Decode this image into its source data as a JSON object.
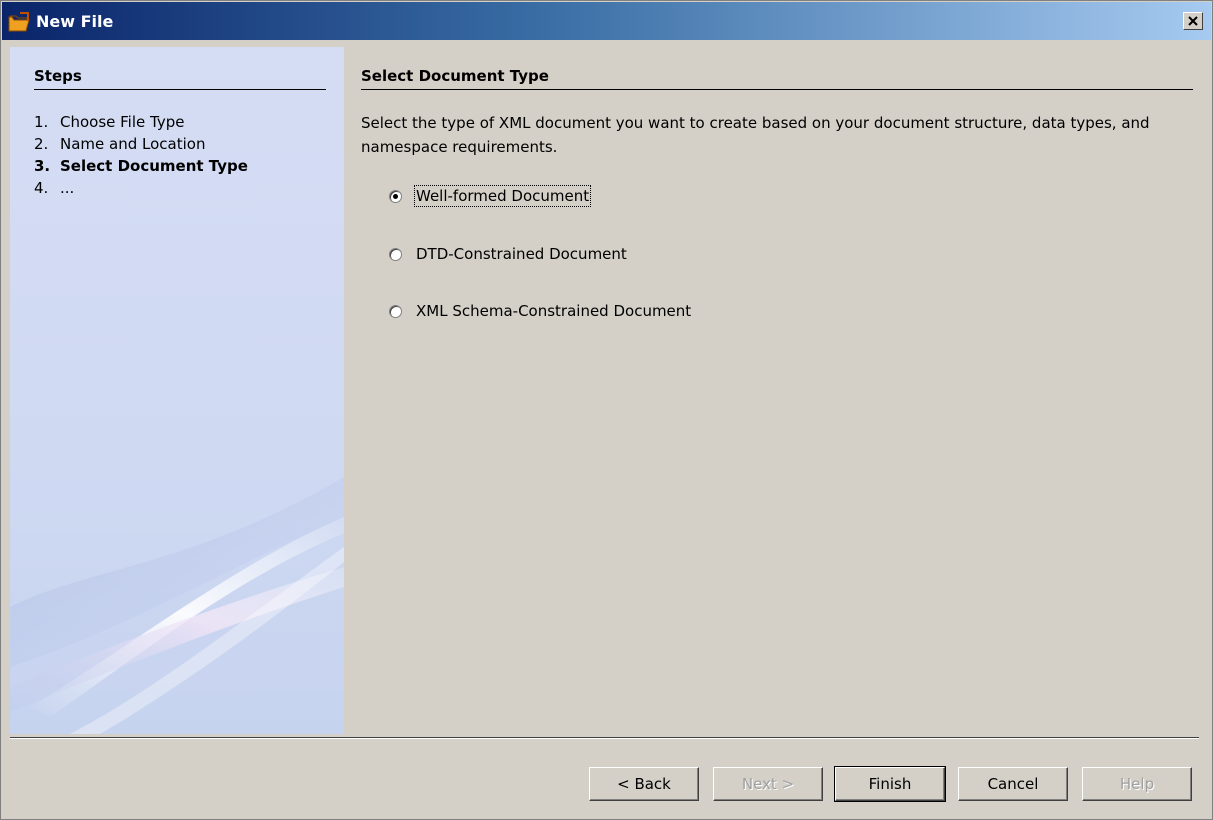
{
  "window": {
    "title": "New File",
    "close_glyph": "✕"
  },
  "steps": {
    "heading": "Steps",
    "items": [
      {
        "number": "1.",
        "label": "Choose File Type",
        "current": false
      },
      {
        "number": "2.",
        "label": "Name and Location",
        "current": false
      },
      {
        "number": "3.",
        "label": "Select Document Type",
        "current": true
      },
      {
        "number": "4.",
        "label": "...",
        "current": false
      }
    ]
  },
  "content": {
    "heading": "Select Document Type",
    "description": "Select the type of XML document you want to create based on your document structure, data types, and namespace requirements.",
    "options": [
      {
        "label": "Well-formed Document",
        "selected": true
      },
      {
        "label": "DTD-Constrained Document",
        "selected": false
      },
      {
        "label": "XML Schema-Constrained Document",
        "selected": false
      }
    ]
  },
  "buttons": {
    "back": "< Back",
    "next": "Next >",
    "finish": "Finish",
    "cancel": "Cancel",
    "help": "Help"
  },
  "icons": {
    "title_icon": "folder-icon",
    "close_icon": "close-icon"
  }
}
